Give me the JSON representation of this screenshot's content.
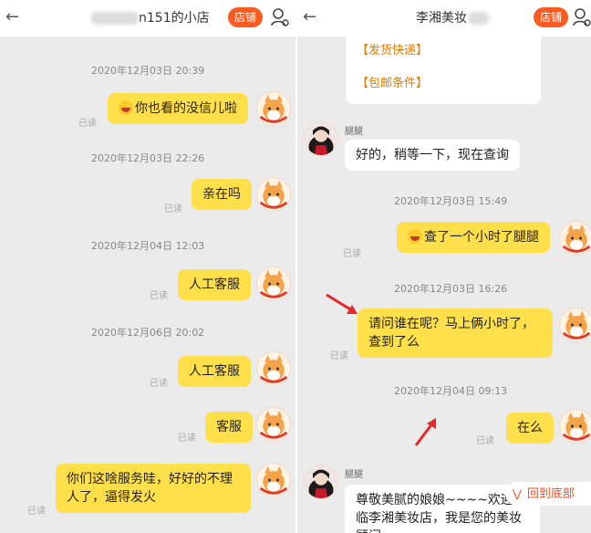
{
  "left": {
    "title_suffix": "n151的小店",
    "shop_label": "店铺",
    "messages": [
      {
        "time": "2020年12月03日 20:39",
        "text": "你也看的没信儿啦",
        "read": "已读"
      },
      {
        "time": "2020年12月03日 22:26",
        "text": "亲在吗",
        "read": "已读"
      },
      {
        "time": "2020年12月04日 12:03",
        "text": "人工客服",
        "read": "已读"
      },
      {
        "time": "2020年12月06日 20:02",
        "text": "人工客服",
        "read": "已读"
      },
      {
        "text": "客服",
        "read": "已读"
      },
      {
        "text": "你们这啥服务哇，好好的不理人了，逼得发火",
        "read": "已读"
      }
    ]
  },
  "right": {
    "title_prefix": "李湘美妆",
    "shop_label": "店铺",
    "card_links": [
      "【发货快递】",
      "【包邮条件】"
    ],
    "agent_name": "腿腿",
    "messages": [
      {
        "text": "好的，稍等一下，现在查询"
      },
      {
        "time": "2020年12月03日 15:49",
        "text": "查了一个小时了腿腿",
        "read": "已读"
      },
      {
        "time": "2020年12月03日 16:26",
        "text": "请问谁在呢？马上俩小时了，查到了么",
        "read": "已读"
      },
      {
        "time": "2020年12月04日 09:13",
        "text": "在么",
        "read": "已读"
      },
      {
        "text": "尊敬美腻的娘娘~~~~欢迎光临李湘美妆店，我是您的美妆顾问"
      }
    ],
    "agent_name_2": "腿腿",
    "scroll_bottom_label": "回到底部"
  },
  "colors": {
    "bubble": "#ffdf4a",
    "accent": "#ff5a1f",
    "annotation_arrow": "#e8262b",
    "background": "#ebebeb"
  }
}
